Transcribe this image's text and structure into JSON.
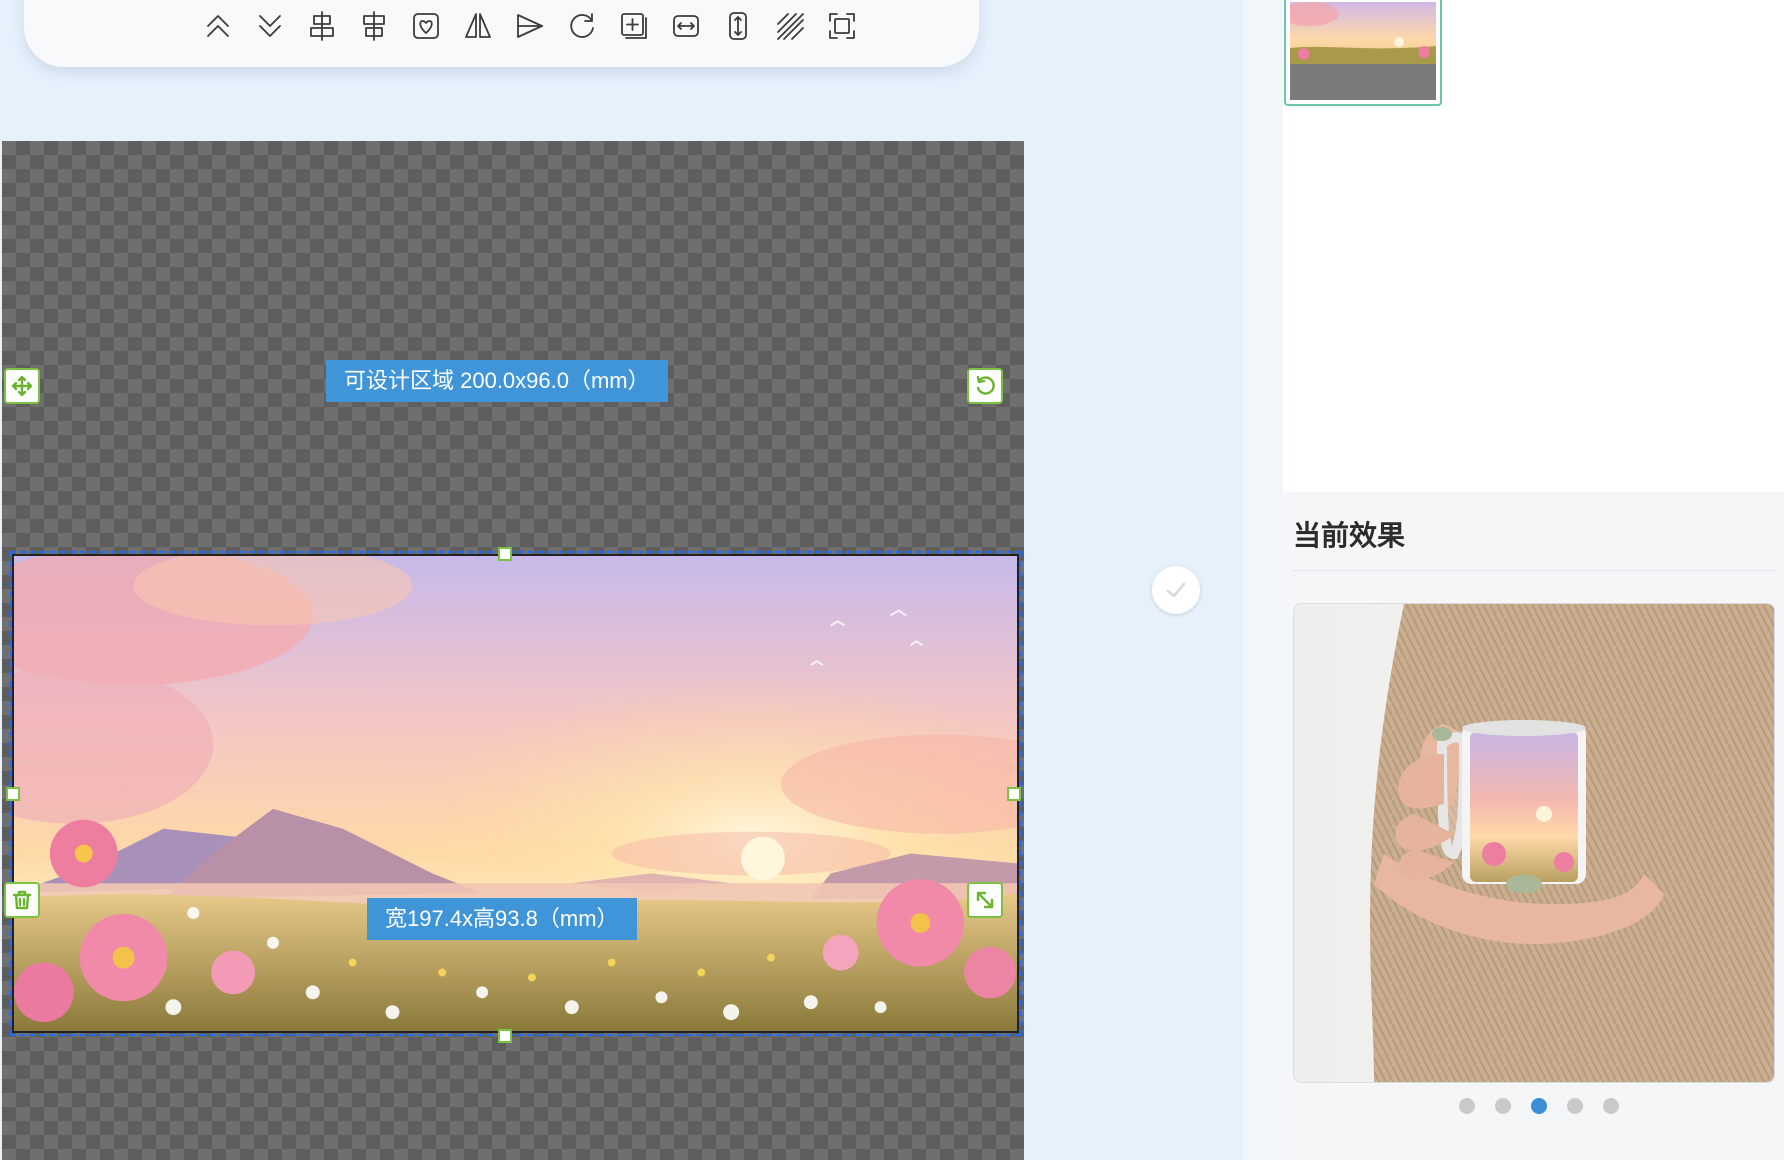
{
  "toolbar": {
    "icons": [
      "move-up-layer-icon",
      "move-down-layer-icon",
      "align-horizontal-center-icon",
      "align-vertical-center-icon",
      "fit-shape-icon",
      "flip-horizontal-icon",
      "flip-vertical-icon",
      "rotate-icon",
      "add-layer-icon",
      "stretch-horizontal-icon",
      "stretch-vertical-icon",
      "tile-pattern-icon",
      "fit-canvas-icon"
    ]
  },
  "canvas": {
    "design_area_label": "可设计区域 200.0x96.0（mm）",
    "size_label": "宽197.4x高93.8（mm）"
  },
  "right_panel": {
    "effect_title": "当前效果",
    "carousel_count": 5,
    "carousel_active_index": 2
  },
  "colors": {
    "accent": "#3f95d8",
    "handle_green": "#7cc242",
    "selection_blue": "#1e6cff",
    "thumb_border": "#69c6a8"
  }
}
